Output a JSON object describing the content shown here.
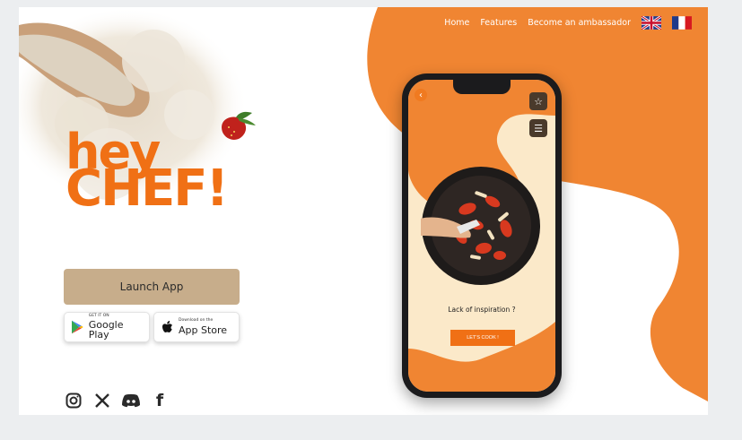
{
  "nav": {
    "items": [
      {
        "label": "Home"
      },
      {
        "label": "Features"
      },
      {
        "label": "Become an ambassador"
      }
    ],
    "flags": [
      "uk-flag-icon",
      "fr-flag-icon"
    ]
  },
  "hero": {
    "logo_line1": "hey",
    "logo_line2": "CHEF!",
    "launch_label": "Launch App",
    "google_play": {
      "small": "GET IT ON",
      "big": "Google Play"
    },
    "app_store": {
      "small": "Download on the",
      "big": "App Store"
    },
    "social": [
      "instagram-icon",
      "x-icon",
      "discord-icon",
      "facebook-icon"
    ],
    "facebook_glyph": "f"
  },
  "phone": {
    "prompt": "Lack of inspiration ?",
    "cta": "LET'S COOK !"
  },
  "colors": {
    "accent": "#f07015",
    "orange_bg": "#f08532",
    "launch_bg": "#c7ad8b",
    "screen_bg": "#fbe9c9"
  }
}
